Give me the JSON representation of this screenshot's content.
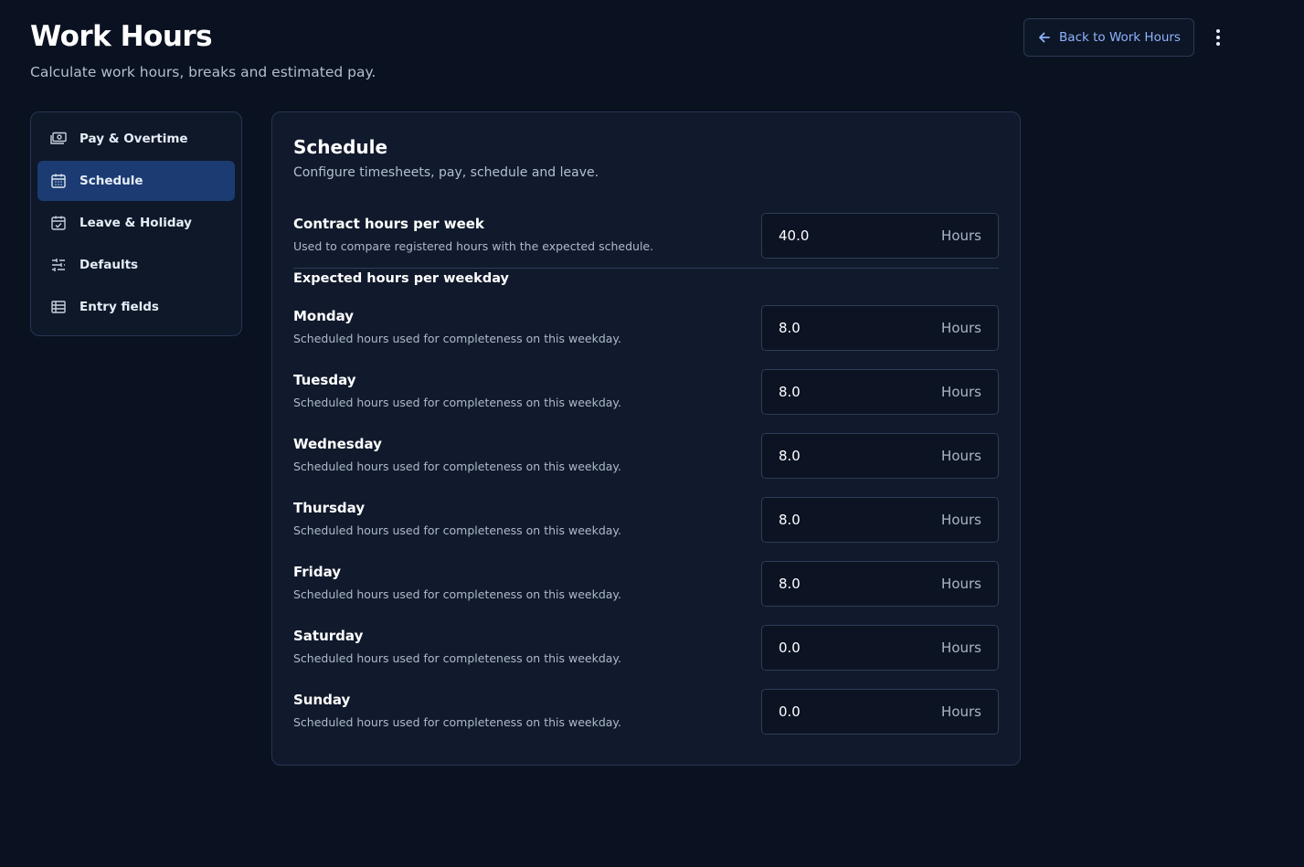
{
  "header": {
    "title": "Work Hours",
    "subtitle": "Calculate work hours, breaks and estimated pay.",
    "back_button_label": "Back to Work Hours"
  },
  "sidebar": {
    "items": [
      {
        "label": "Pay & Overtime",
        "icon": "banknote-icon",
        "active": false
      },
      {
        "label": "Schedule",
        "icon": "calendar-icon",
        "active": true
      },
      {
        "label": "Leave & Holiday",
        "icon": "calendar-check-icon",
        "active": false
      },
      {
        "label": "Defaults",
        "icon": "sliders-icon",
        "active": false
      },
      {
        "label": "Entry fields",
        "icon": "list-table-icon",
        "active": false
      }
    ]
  },
  "schedule": {
    "title": "Schedule",
    "subtitle": "Configure timesheets, pay, schedule and leave.",
    "contract": {
      "label": "Contract hours per week",
      "description": "Used to compare registered hours with the expected schedule.",
      "value": "40.0",
      "unit": "Hours"
    },
    "weekday_heading": "Expected hours per weekday",
    "weekdays": [
      {
        "label": "Monday",
        "description": "Scheduled hours used for completeness on this weekday.",
        "value": "8.0",
        "unit": "Hours"
      },
      {
        "label": "Tuesday",
        "description": "Scheduled hours used for completeness on this weekday.",
        "value": "8.0",
        "unit": "Hours"
      },
      {
        "label": "Wednesday",
        "description": "Scheduled hours used for completeness on this weekday.",
        "value": "8.0",
        "unit": "Hours"
      },
      {
        "label": "Thursday",
        "description": "Scheduled hours used for completeness on this weekday.",
        "value": "8.0",
        "unit": "Hours"
      },
      {
        "label": "Friday",
        "description": "Scheduled hours used for completeness on this weekday.",
        "value": "8.0",
        "unit": "Hours"
      },
      {
        "label": "Saturday",
        "description": "Scheduled hours used for completeness on this weekday.",
        "value": "0.0",
        "unit": "Hours"
      },
      {
        "label": "Sunday",
        "description": "Scheduled hours used for completeness on this weekday.",
        "value": "0.0",
        "unit": "Hours"
      }
    ]
  },
  "colors": {
    "background": "#0a1120",
    "panel": "#111a2c",
    "active_nav": "#1b3b72",
    "link_accent": "#8fb3ff"
  }
}
